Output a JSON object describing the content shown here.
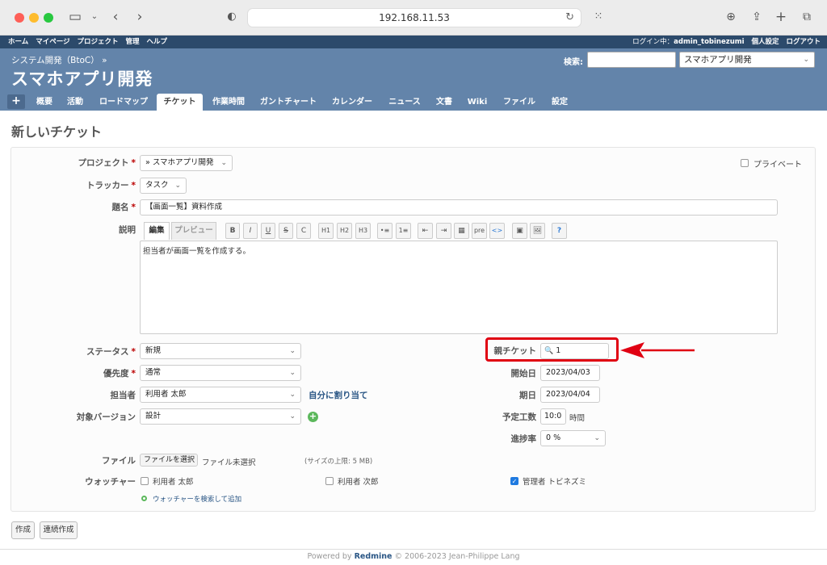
{
  "browser": {
    "url": "192.168.11.53"
  },
  "topmenu": {
    "left": [
      "ホーム",
      "マイページ",
      "プロジェクト",
      "管理",
      "ヘルプ"
    ],
    "login_label": "ログイン中：",
    "login_user": "admin_tobinezumi",
    "personal_settings": "個人設定",
    "logout": "ログアウト"
  },
  "header": {
    "breadcrumb": "システム開発（BtoC） »",
    "project_title": "スマホアプリ開発",
    "search_label": "検索:",
    "project_jump": "スマホアプリ開発"
  },
  "tabs": {
    "plus": "+",
    "items": [
      "概要",
      "活動",
      "ロードマップ",
      "チケット",
      "作業時間",
      "ガントチャート",
      "カレンダー",
      "ニュース",
      "文書",
      "Wiki",
      "ファイル",
      "設定"
    ],
    "selected": "チケット"
  },
  "page": {
    "title": "新しいチケット"
  },
  "form": {
    "project_label": "プロジェクト",
    "project_value": "» スマホアプリ開発",
    "private_label": "プライベート",
    "tracker_label": "トラッカー",
    "tracker_value": "タスク",
    "subject_label": "題名",
    "subject_value": "【画面一覧】資料作成",
    "description_label": "説明",
    "editor_tab_edit": "編集",
    "editor_tab_preview": "プレビュー",
    "toolbar": [
      "B",
      "I",
      "U",
      "S",
      "C",
      "H1",
      "H2",
      "H3",
      "•≡",
      "1≡",
      "⇤",
      "⇥",
      "▦",
      "pre",
      "<>",
      "▣",
      "🖼",
      "?"
    ],
    "description_value": "担当者が画面一覧を作成する。",
    "status_label": "ステータス",
    "status_value": "新規",
    "priority_label": "優先度",
    "priority_value": "通常",
    "assignee_label": "担当者",
    "assignee_value": "利用者 太郎",
    "assign_to_me": "自分に割り当て",
    "version_label": "対象バージョン",
    "version_value": "設計",
    "parent_label": "親チケット",
    "parent_value": "1",
    "start_label": "開始日",
    "start_value": "2023/04/03",
    "due_label": "期日",
    "due_value": "2023/04/04",
    "estimated_label": "予定工数",
    "estimated_value": "10:0",
    "estimated_unit": "時間",
    "done_label": "進捗率",
    "done_value": "0 %",
    "file_label": "ファイル",
    "file_button": "ファイルを選択",
    "file_none": "ファイル未選択",
    "file_limit": "(サイズの上限: 5 MB)",
    "watchers_label": "ウォッチャー",
    "watchers": [
      {
        "name": "利用者 太郎",
        "checked": false
      },
      {
        "name": "利用者 次郎",
        "checked": false
      },
      {
        "name": "管理者 トビネズミ",
        "checked": true
      }
    ],
    "add_watchers": "ウォッチャーを検索して追加"
  },
  "buttons": {
    "create": "作成",
    "create_continue": "連続作成"
  },
  "footer": {
    "prefix": "Powered by",
    "brand": "Redmine",
    "suffix": "© 2006-2023 Jean-Philippe Lang"
  },
  "colors": {
    "header_bg": "#6384aa",
    "topmenu_bg": "#2c4a6b",
    "highlight": "#e00012",
    "link": "#2a5685"
  }
}
